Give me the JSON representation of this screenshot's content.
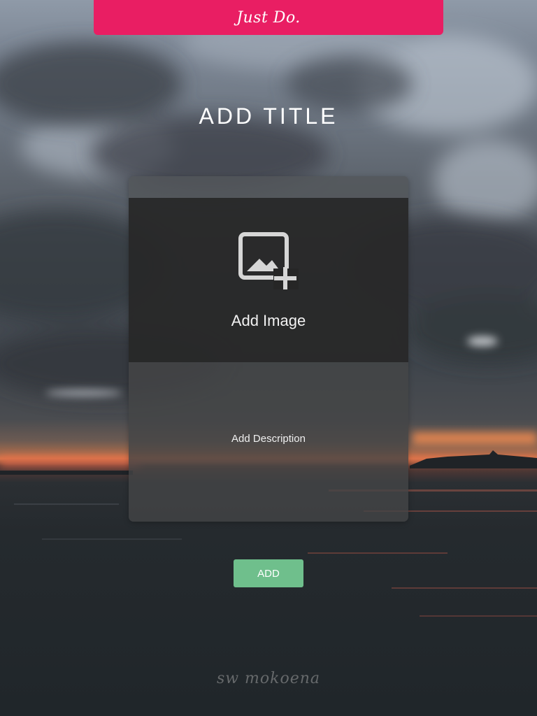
{
  "header": {
    "brand": "Just Do.",
    "color": "#e91e63"
  },
  "title": "ADD TITLE",
  "card": {
    "image": {
      "icon": "add-photo-icon",
      "label": "Add Image"
    },
    "description": {
      "label": "Add Description"
    }
  },
  "add_button": {
    "label": "ADD",
    "color": "#6fbf8c"
  },
  "footer": {
    "signature": "sw mokoena"
  }
}
